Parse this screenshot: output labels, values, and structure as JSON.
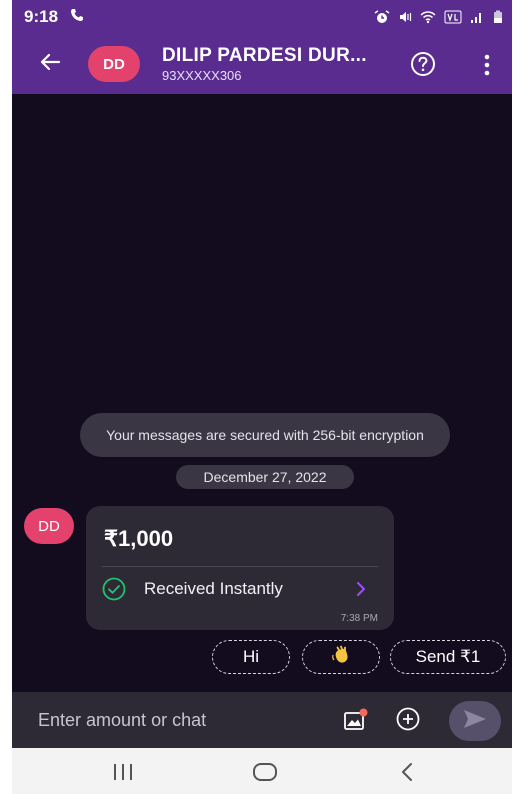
{
  "status_bar": {
    "time": "9:18",
    "icons": [
      "phone-call-icon",
      "alarm-icon",
      "mute-icon",
      "wifi-icon",
      "volte-icon",
      "signal-icon",
      "battery-icon"
    ]
  },
  "header": {
    "back_icon": "arrow-left-icon",
    "avatar_initials": "DD",
    "contact_name": "DILIP PARDESI DUR...",
    "contact_phone": "93XXXXX306",
    "help_icon": "question-circle-icon",
    "more_icon": "vertical-dots-icon"
  },
  "chat": {
    "security_notice": "Your messages are secured with 256-bit encryption",
    "date_label": "December 27, 2022",
    "sender_initials": "DD",
    "message": {
      "amount": "₹1,000",
      "status": "Received Instantly",
      "time": "7:38 PM"
    },
    "quick_replies": {
      "hi": "Hi",
      "wave": "👋",
      "send": "Send ₹1"
    }
  },
  "input_bar": {
    "placeholder": "Enter amount or chat",
    "icons": [
      "image-gallery-icon",
      "plus-circle-icon",
      "send-arrow-icon"
    ]
  },
  "nav_bar": {
    "icons": [
      "recent-apps-icon",
      "home-icon",
      "back-icon"
    ]
  },
  "colors": {
    "brand_purple": "#5a2c8f",
    "background": "#130b1e",
    "bubble": "#2d2a36",
    "avatar_pink": "#e2426c",
    "success_green": "#21c36b",
    "accent_purple": "#9d4dff"
  }
}
